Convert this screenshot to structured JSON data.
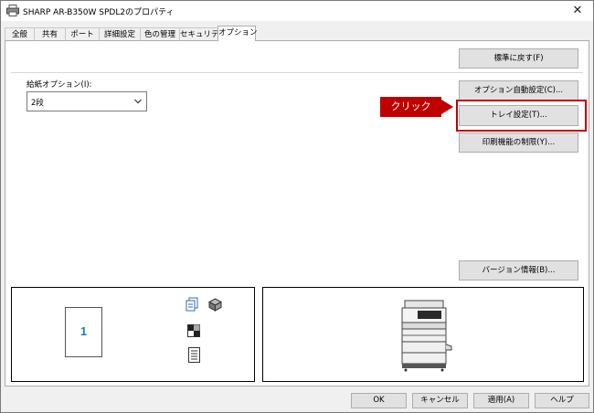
{
  "window": {
    "title": "SHARP AR-B350W SPDL2のプロパティ",
    "close_glyph": "✕"
  },
  "tabs": [
    {
      "label": "全般"
    },
    {
      "label": "共有"
    },
    {
      "label": "ポート"
    },
    {
      "label": "詳細設定"
    },
    {
      "label": "色の管理"
    },
    {
      "label": "セキュリティ"
    },
    {
      "label": "オプション"
    }
  ],
  "active_tab": "オプション",
  "panel": {
    "restore_defaults_label": "標準に戻す(F)",
    "paper_options_label": "給紙オプション(I):",
    "paper_options_value": "2段",
    "auto_config_label": "オプション自動設定(C)...",
    "tray_settings_label": "トレイ設定(T)...",
    "print_restrict_label": "印刷機能の制限(Y)...",
    "version_info_label": "バージョン情報(B)...",
    "preview_page_number": "1",
    "callout_text": "クリック"
  },
  "footer": {
    "ok_label": "OK",
    "cancel_label": "キャンセル",
    "apply_label": "適用(A)",
    "help_label": "ヘルプ"
  },
  "colors": {
    "accent_red": "#c00000",
    "page_number_blue": "#1a7ac9"
  },
  "icons": [
    "printer-icon",
    "close-icon",
    "chevron-down-icon",
    "duplex-icon",
    "staple-icon",
    "color-mode-icon",
    "document-icon",
    "copier-image"
  ]
}
